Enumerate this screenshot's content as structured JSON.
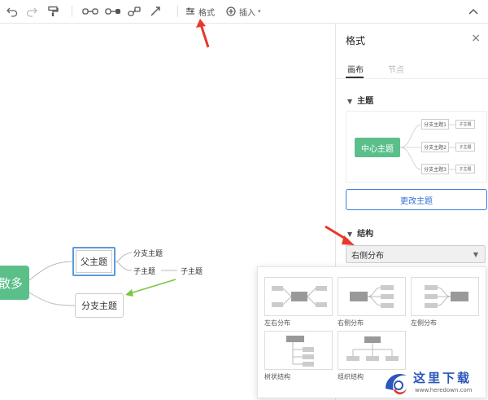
{
  "toolbar": {
    "format_label": "格式",
    "insert_label": "插入"
  },
  "canvas": {
    "center_node": "散多",
    "parent_node": "父主题",
    "branch_node": "分支主题",
    "sub_top": "分支主题",
    "sub_mid": "子主题",
    "sub_right": "子主题"
  },
  "panel": {
    "title": "格式",
    "tabs": [
      "画布",
      "节点"
    ],
    "theme_section": "主题",
    "theme_preview": {
      "center": "中心主题",
      "branches": [
        "分支主题1",
        "分支主题2",
        "分支主题3"
      ],
      "sub": "子主题"
    },
    "change_theme_button": "更改主题",
    "structure_section": "结构",
    "structure_selected": "右侧分布"
  },
  "dropdown": {
    "options": [
      "左右分布",
      "右侧分布",
      "左侧分布",
      "树状结构",
      "组织结构"
    ]
  },
  "watermark": {
    "text": "这里下载",
    "url": "www.heredown.com"
  },
  "colors": {
    "accent_blue": "#3d7be0",
    "center_green": "#5bbf8a",
    "arrow_red": "#e8382b",
    "arrow_green": "#7cc542"
  }
}
